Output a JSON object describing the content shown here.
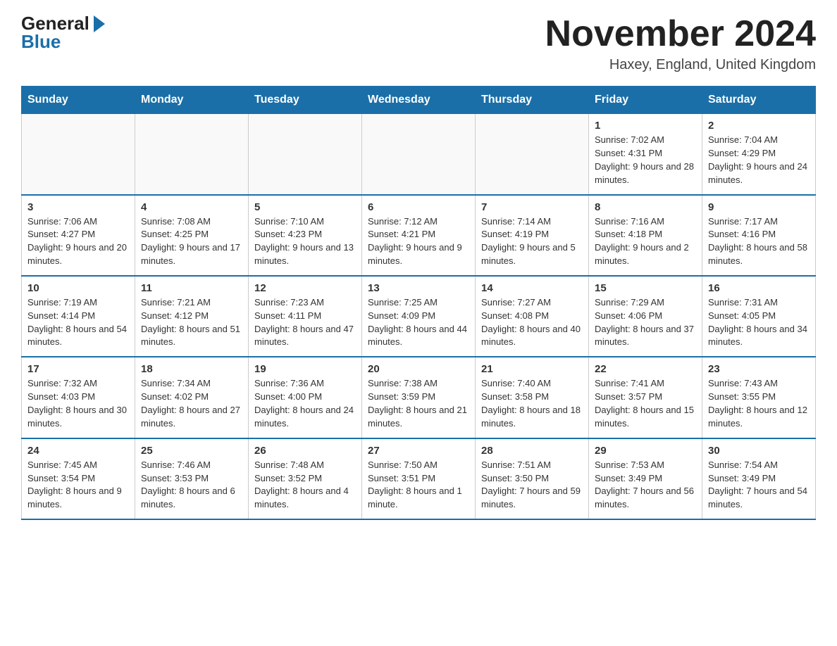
{
  "header": {
    "logo_general": "General",
    "logo_blue": "Blue",
    "month_title": "November 2024",
    "location": "Haxey, England, United Kingdom"
  },
  "weekdays": [
    "Sunday",
    "Monday",
    "Tuesday",
    "Wednesday",
    "Thursday",
    "Friday",
    "Saturday"
  ],
  "weeks": [
    [
      {
        "day": "",
        "info": ""
      },
      {
        "day": "",
        "info": ""
      },
      {
        "day": "",
        "info": ""
      },
      {
        "day": "",
        "info": ""
      },
      {
        "day": "",
        "info": ""
      },
      {
        "day": "1",
        "info": "Sunrise: 7:02 AM\nSunset: 4:31 PM\nDaylight: 9 hours and 28 minutes."
      },
      {
        "day": "2",
        "info": "Sunrise: 7:04 AM\nSunset: 4:29 PM\nDaylight: 9 hours and 24 minutes."
      }
    ],
    [
      {
        "day": "3",
        "info": "Sunrise: 7:06 AM\nSunset: 4:27 PM\nDaylight: 9 hours and 20 minutes."
      },
      {
        "day": "4",
        "info": "Sunrise: 7:08 AM\nSunset: 4:25 PM\nDaylight: 9 hours and 17 minutes."
      },
      {
        "day": "5",
        "info": "Sunrise: 7:10 AM\nSunset: 4:23 PM\nDaylight: 9 hours and 13 minutes."
      },
      {
        "day": "6",
        "info": "Sunrise: 7:12 AM\nSunset: 4:21 PM\nDaylight: 9 hours and 9 minutes."
      },
      {
        "day": "7",
        "info": "Sunrise: 7:14 AM\nSunset: 4:19 PM\nDaylight: 9 hours and 5 minutes."
      },
      {
        "day": "8",
        "info": "Sunrise: 7:16 AM\nSunset: 4:18 PM\nDaylight: 9 hours and 2 minutes."
      },
      {
        "day": "9",
        "info": "Sunrise: 7:17 AM\nSunset: 4:16 PM\nDaylight: 8 hours and 58 minutes."
      }
    ],
    [
      {
        "day": "10",
        "info": "Sunrise: 7:19 AM\nSunset: 4:14 PM\nDaylight: 8 hours and 54 minutes."
      },
      {
        "day": "11",
        "info": "Sunrise: 7:21 AM\nSunset: 4:12 PM\nDaylight: 8 hours and 51 minutes."
      },
      {
        "day": "12",
        "info": "Sunrise: 7:23 AM\nSunset: 4:11 PM\nDaylight: 8 hours and 47 minutes."
      },
      {
        "day": "13",
        "info": "Sunrise: 7:25 AM\nSunset: 4:09 PM\nDaylight: 8 hours and 44 minutes."
      },
      {
        "day": "14",
        "info": "Sunrise: 7:27 AM\nSunset: 4:08 PM\nDaylight: 8 hours and 40 minutes."
      },
      {
        "day": "15",
        "info": "Sunrise: 7:29 AM\nSunset: 4:06 PM\nDaylight: 8 hours and 37 minutes."
      },
      {
        "day": "16",
        "info": "Sunrise: 7:31 AM\nSunset: 4:05 PM\nDaylight: 8 hours and 34 minutes."
      }
    ],
    [
      {
        "day": "17",
        "info": "Sunrise: 7:32 AM\nSunset: 4:03 PM\nDaylight: 8 hours and 30 minutes."
      },
      {
        "day": "18",
        "info": "Sunrise: 7:34 AM\nSunset: 4:02 PM\nDaylight: 8 hours and 27 minutes."
      },
      {
        "day": "19",
        "info": "Sunrise: 7:36 AM\nSunset: 4:00 PM\nDaylight: 8 hours and 24 minutes."
      },
      {
        "day": "20",
        "info": "Sunrise: 7:38 AM\nSunset: 3:59 PM\nDaylight: 8 hours and 21 minutes."
      },
      {
        "day": "21",
        "info": "Sunrise: 7:40 AM\nSunset: 3:58 PM\nDaylight: 8 hours and 18 minutes."
      },
      {
        "day": "22",
        "info": "Sunrise: 7:41 AM\nSunset: 3:57 PM\nDaylight: 8 hours and 15 minutes."
      },
      {
        "day": "23",
        "info": "Sunrise: 7:43 AM\nSunset: 3:55 PM\nDaylight: 8 hours and 12 minutes."
      }
    ],
    [
      {
        "day": "24",
        "info": "Sunrise: 7:45 AM\nSunset: 3:54 PM\nDaylight: 8 hours and 9 minutes."
      },
      {
        "day": "25",
        "info": "Sunrise: 7:46 AM\nSunset: 3:53 PM\nDaylight: 8 hours and 6 minutes."
      },
      {
        "day": "26",
        "info": "Sunrise: 7:48 AM\nSunset: 3:52 PM\nDaylight: 8 hours and 4 minutes."
      },
      {
        "day": "27",
        "info": "Sunrise: 7:50 AM\nSunset: 3:51 PM\nDaylight: 8 hours and 1 minute."
      },
      {
        "day": "28",
        "info": "Sunrise: 7:51 AM\nSunset: 3:50 PM\nDaylight: 7 hours and 59 minutes."
      },
      {
        "day": "29",
        "info": "Sunrise: 7:53 AM\nSunset: 3:49 PM\nDaylight: 7 hours and 56 minutes."
      },
      {
        "day": "30",
        "info": "Sunrise: 7:54 AM\nSunset: 3:49 PM\nDaylight: 7 hours and 54 minutes."
      }
    ]
  ]
}
